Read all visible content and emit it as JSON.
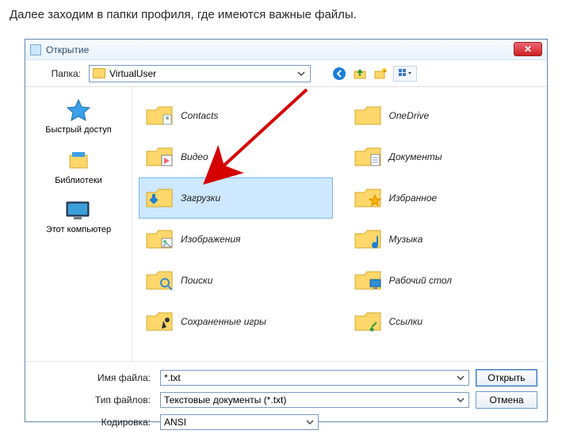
{
  "intro_text": "Далее заходим в папки профиля, где имеются важные файлы.",
  "dialog": {
    "title": "Открытие",
    "close_symbol": "✕",
    "folder_label": "Папка:",
    "current_folder": "VirtualUser"
  },
  "toolbar_icons": {
    "back": "back-icon",
    "up": "up-folder-icon",
    "newfolder": "new-folder-icon",
    "views": "views-icon"
  },
  "sidebar": {
    "items": [
      {
        "label": "Быстрый доступ",
        "icon": "star"
      },
      {
        "label": "Библиотеки",
        "icon": "libraries"
      },
      {
        "label": "Этот компьютер",
        "icon": "computer"
      }
    ]
  },
  "files": {
    "col1": [
      {
        "label": "Contacts",
        "overlay": "contacts"
      },
      {
        "label": "Видео",
        "overlay": "video"
      },
      {
        "label": "Загрузки",
        "overlay": "download",
        "selected": true
      },
      {
        "label": "Изображения",
        "overlay": "image"
      },
      {
        "label": "Поиски",
        "overlay": "search"
      },
      {
        "label": "Сохраненные игры",
        "overlay": "games"
      }
    ],
    "col2": [
      {
        "label": "OneDrive",
        "overlay": "cloud"
      },
      {
        "label": "Документы",
        "overlay": "doc"
      },
      {
        "label": "Избранное",
        "overlay": "star"
      },
      {
        "label": "Музыка",
        "overlay": "music"
      },
      {
        "label": "Рабочий стол",
        "overlay": "desktop"
      },
      {
        "label": "Ссылки",
        "overlay": "link"
      }
    ]
  },
  "bottom": {
    "filename_label": "Имя файла:",
    "filename_value": "*.txt",
    "filetype_label": "Тип файлов:",
    "filetype_value": "Текстовые документы (*.txt)",
    "encoding_label": "Кодировка:",
    "encoding_value": "ANSI",
    "open_btn": "Открыть",
    "cancel_btn": "Отмена"
  }
}
